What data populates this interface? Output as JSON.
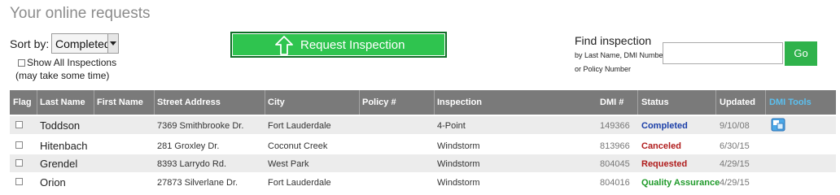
{
  "page": {
    "title": "Your online requests"
  },
  "sort": {
    "label": "Sort by:",
    "value": "Completed"
  },
  "filter": {
    "show_all_label": "Show All Inspections",
    "note": "(may take some time)"
  },
  "request_button": {
    "label": "Request Inspection",
    "icon": "up-arrow-icon"
  },
  "find": {
    "title": "Find inspection",
    "sub1": "by Last Name, DMI Number",
    "sub2": "or Policy Number",
    "input_value": "",
    "go_label": "Go"
  },
  "table": {
    "columns": [
      "Flag",
      "Last Name",
      "First Name",
      "Street Address",
      "City",
      "Policy #",
      "Inspection",
      "DMI #",
      "Status",
      "Updated",
      "DMI Tools"
    ],
    "rows": [
      {
        "last": "Toddson",
        "first": "",
        "address": "7369 Smithbrooke Dr.",
        "city": "Fort Lauderdale",
        "policy": "",
        "inspection": "4-Point",
        "dmi": "149366",
        "status": "Completed",
        "updated": "9/10/08",
        "tool": true
      },
      {
        "last": "Hitenbach",
        "first": "",
        "address": "281 Groxley Dr.",
        "city": "Coconut Creek",
        "policy": "",
        "inspection": "Windstorm",
        "dmi": "813966",
        "status": "Canceled",
        "updated": "6/30/15",
        "tool": false
      },
      {
        "last": "Grendel",
        "first": "",
        "address": "8393 Larrydo Rd.",
        "city": "West Park",
        "policy": "",
        "inspection": "Windstorm",
        "dmi": "804045",
        "status": "Requested",
        "updated": "4/29/15",
        "tool": false
      },
      {
        "last": "Orion",
        "first": "",
        "address": "27873 Silverlane Dr.",
        "city": "Fort Lauderdale",
        "policy": "",
        "inspection": "Windstorm",
        "dmi": "804016",
        "status": "Quality Assurance",
        "updated": "4/29/15",
        "tool": false
      }
    ]
  },
  "colors": {
    "button_green": "#2fc44f",
    "header_gray": "#7a7a7a",
    "tools_blue": "#5bc0f0",
    "completed": "#1a3ea8",
    "canceled": "#b01c1c",
    "qa": "#1f9a2a"
  }
}
